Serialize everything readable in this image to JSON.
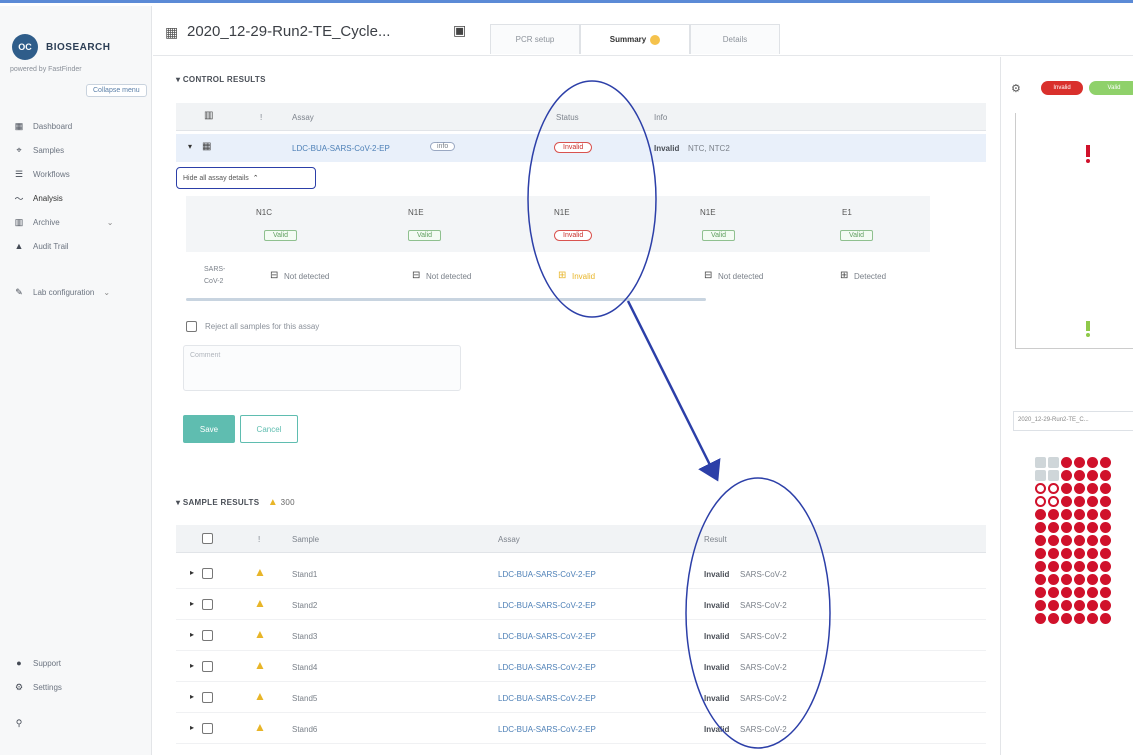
{
  "app": {
    "logo_mark": "OC",
    "logo_text": "BIOSEARCH",
    "powered_by": "powered by FastFinder",
    "collapse_label": "Collapse menu"
  },
  "sidebar": {
    "items": [
      {
        "icon": "dashboard-icon",
        "glyph": "▦",
        "label": "Dashboard"
      },
      {
        "icon": "samples-icon",
        "glyph": "⌖",
        "label": "Samples"
      },
      {
        "icon": "workflows-icon",
        "glyph": "☰",
        "label": "Workflows"
      },
      {
        "icon": "analysis-icon",
        "glyph": "〜",
        "label": "Analysis"
      },
      {
        "icon": "archive-icon",
        "glyph": "▥",
        "label": "Archive"
      },
      {
        "icon": "audit-trail-icon",
        "glyph": "▲",
        "label": "Audit Trail"
      },
      {
        "icon": "lab-config-icon",
        "glyph": "✎",
        "label": "Lab configuration"
      }
    ],
    "bottom_items": [
      {
        "icon": "support-icon",
        "glyph": "●",
        "label": "Support"
      },
      {
        "icon": "settings-icon",
        "glyph": "⚙",
        "label": "Settings"
      },
      {
        "icon": "user-icon",
        "glyph": "⚲",
        "label": ""
      }
    ]
  },
  "header": {
    "run_title": "2020_12-29-Run2-TE_Cycle...",
    "tabs": [
      {
        "label": "PCR setup"
      },
      {
        "label": "Summary"
      },
      {
        "label": "Details"
      }
    ]
  },
  "control_results": {
    "title": "CONTROL RESULTS",
    "columns": [
      "!",
      "Assay",
      "Status",
      "Info"
    ],
    "row": {
      "assay": "LDC-BUA-SARS-CoV-2-EP",
      "tag": "info",
      "status": "Invalid",
      "info_bold": "Invalid",
      "info_rest": "NTC, NTC2"
    },
    "view_button": "Hide all assay details",
    "genes": [
      {
        "name": "N1C",
        "status": "Valid",
        "result": "Not detected"
      },
      {
        "name": "N1E",
        "status": "Valid",
        "result": "Not detected"
      },
      {
        "name": "N1E",
        "status": "Invalid",
        "result": "Invalid"
      },
      {
        "name": "N1E",
        "status": "Valid",
        "result": "Not detected"
      },
      {
        "name": "E1",
        "status": "Valid",
        "result": "Detected"
      }
    ],
    "row_label_1": "SARS-",
    "row_label_2": "CoV-2",
    "reject_label": "Reject all samples for this assay",
    "comment_placeholder": "Comment",
    "save": "Save",
    "cancel": "Cancel"
  },
  "sample_results": {
    "title": "SAMPLE RESULTS",
    "warning_count": "300",
    "columns": [
      "!",
      "Sample",
      "Assay",
      "Result"
    ],
    "rows": [
      {
        "sample": "Stand1",
        "assay": "LDC-BUA-SARS-CoV-2-EP",
        "result_bold": "Invalid",
        "result_rest": "SARS-CoV-2"
      },
      {
        "sample": "Stand2",
        "assay": "LDC-BUA-SARS-CoV-2-EP",
        "result_bold": "Invalid",
        "result_rest": "SARS-CoV-2"
      },
      {
        "sample": "Stand3",
        "assay": "LDC-BUA-SARS-CoV-2-EP",
        "result_bold": "Invalid",
        "result_rest": "SARS-CoV-2"
      },
      {
        "sample": "Stand4",
        "assay": "LDC-BUA-SARS-CoV-2-EP",
        "result_bold": "Invalid",
        "result_rest": "SARS-CoV-2"
      },
      {
        "sample": "Stand5",
        "assay": "LDC-BUA-SARS-CoV-2-EP",
        "result_bold": "Invalid",
        "result_rest": "SARS-CoV-2"
      },
      {
        "sample": "Stand6",
        "assay": "LDC-BUA-SARS-CoV-2-EP",
        "result_bold": "Invalid",
        "result_rest": "SARS-CoV-2"
      }
    ]
  },
  "right_panel": {
    "legend_invalid": "Invalid",
    "legend_valid": "Valid",
    "plate_select": "2020_12-29-Run2-TE_C..."
  },
  "colors": {
    "accent": "#5fbdb0",
    "invalid": "#d0112b",
    "annotation": "#2c3fa8"
  }
}
